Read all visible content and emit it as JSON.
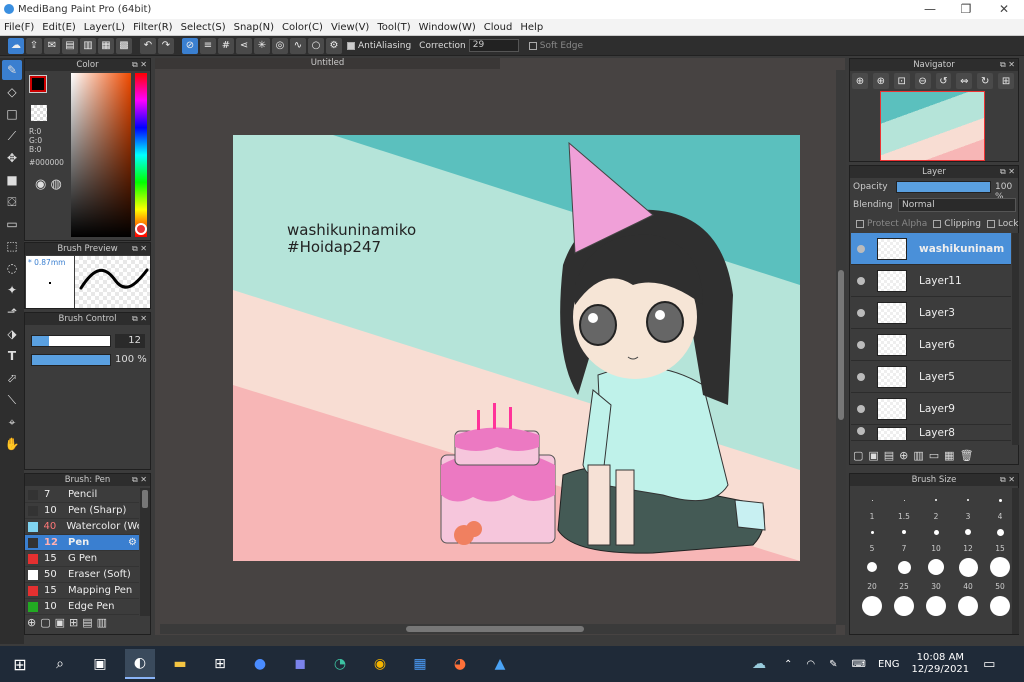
{
  "window": {
    "title": "MediBang Paint Pro (64bit)",
    "min": "—",
    "max": "❐",
    "close": "✕"
  },
  "menu": [
    "File(F)",
    "Edit(E)",
    "Layer(L)",
    "Filter(R)",
    "Select(S)",
    "Snap(N)",
    "Color(C)",
    "View(V)",
    "Tool(T)",
    "Window(W)",
    "Cloud",
    "Help"
  ],
  "toolbar": {
    "antialiasing": "AntiAliasing",
    "correction_label": "Correction",
    "correction_value": "29",
    "soft_edge": "Soft Edge"
  },
  "color_panel": {
    "title": "Color",
    "r": "R:0",
    "g": "G:0",
    "b": "B:0",
    "hex": "#000000",
    "fg": "#000000",
    "bg": "#ffffff"
  },
  "brush_preview": {
    "title": "Brush Preview",
    "size": "* 0.87mm"
  },
  "brush_control": {
    "title": "Brush Control",
    "size_value": "12",
    "opacity_value": "100 %"
  },
  "brush_list": {
    "title": "Brush: Pen",
    "items": [
      {
        "num": "7",
        "name": "Pencil",
        "color": "#333333",
        "numcolor": "#eeeeee"
      },
      {
        "num": "10",
        "name": "Pen (Sharp)",
        "color": "#333333",
        "numcolor": "#eeeeee"
      },
      {
        "num": "40",
        "name": "Watercolor (We",
        "color": "#7fd3f0",
        "numcolor": "#ff7777"
      },
      {
        "num": "12",
        "name": "Pen",
        "color": "#333333",
        "numcolor": "#ff9999"
      },
      {
        "num": "15",
        "name": "G Pen",
        "color": "#e53030",
        "numcolor": "#eeeeee"
      },
      {
        "num": "50",
        "name": "Eraser (Soft)",
        "color": "#ffffff",
        "numcolor": "#eeeeee"
      },
      {
        "num": "15",
        "name": "Mapping Pen",
        "color": "#e53030",
        "numcolor": "#eeeeee"
      },
      {
        "num": "10",
        "name": "Edge Pen",
        "color": "#22aa22",
        "numcolor": "#eeeeee"
      }
    ]
  },
  "document": {
    "title": "Untitled",
    "text_line1": "washikuninamiko",
    "text_line2": "#Hoidap247"
  },
  "navigator": {
    "title": "Navigator"
  },
  "layer_panel": {
    "title": "Layer",
    "opacity_label": "Opacity",
    "opacity_value": "100 %",
    "blending_label": "Blending",
    "blending_value": "Normal",
    "protect_alpha": "Protect Alpha",
    "clipping": "Clipping",
    "lock": "Lock",
    "layers": [
      "washikuninam",
      "Layer11",
      "Layer3",
      "Layer6",
      "Layer5",
      "Layer9",
      "Layer8"
    ]
  },
  "brush_size": {
    "title": "Brush Size",
    "labels": [
      "1",
      "1.5",
      "2",
      "3",
      "4",
      "5",
      "7",
      "10",
      "12",
      "15",
      "20",
      "25",
      "30",
      "40",
      "50"
    ]
  },
  "taskbar": {
    "lang": "ENG",
    "time": "10:08 AM",
    "date": "12/29/2021"
  },
  "colors": {
    "accent": "#3a7fd0",
    "teal": "#5bc0be",
    "mint": "#b5e4d9",
    "peach": "#f8ddd3",
    "pink": "#f7b6b6"
  }
}
